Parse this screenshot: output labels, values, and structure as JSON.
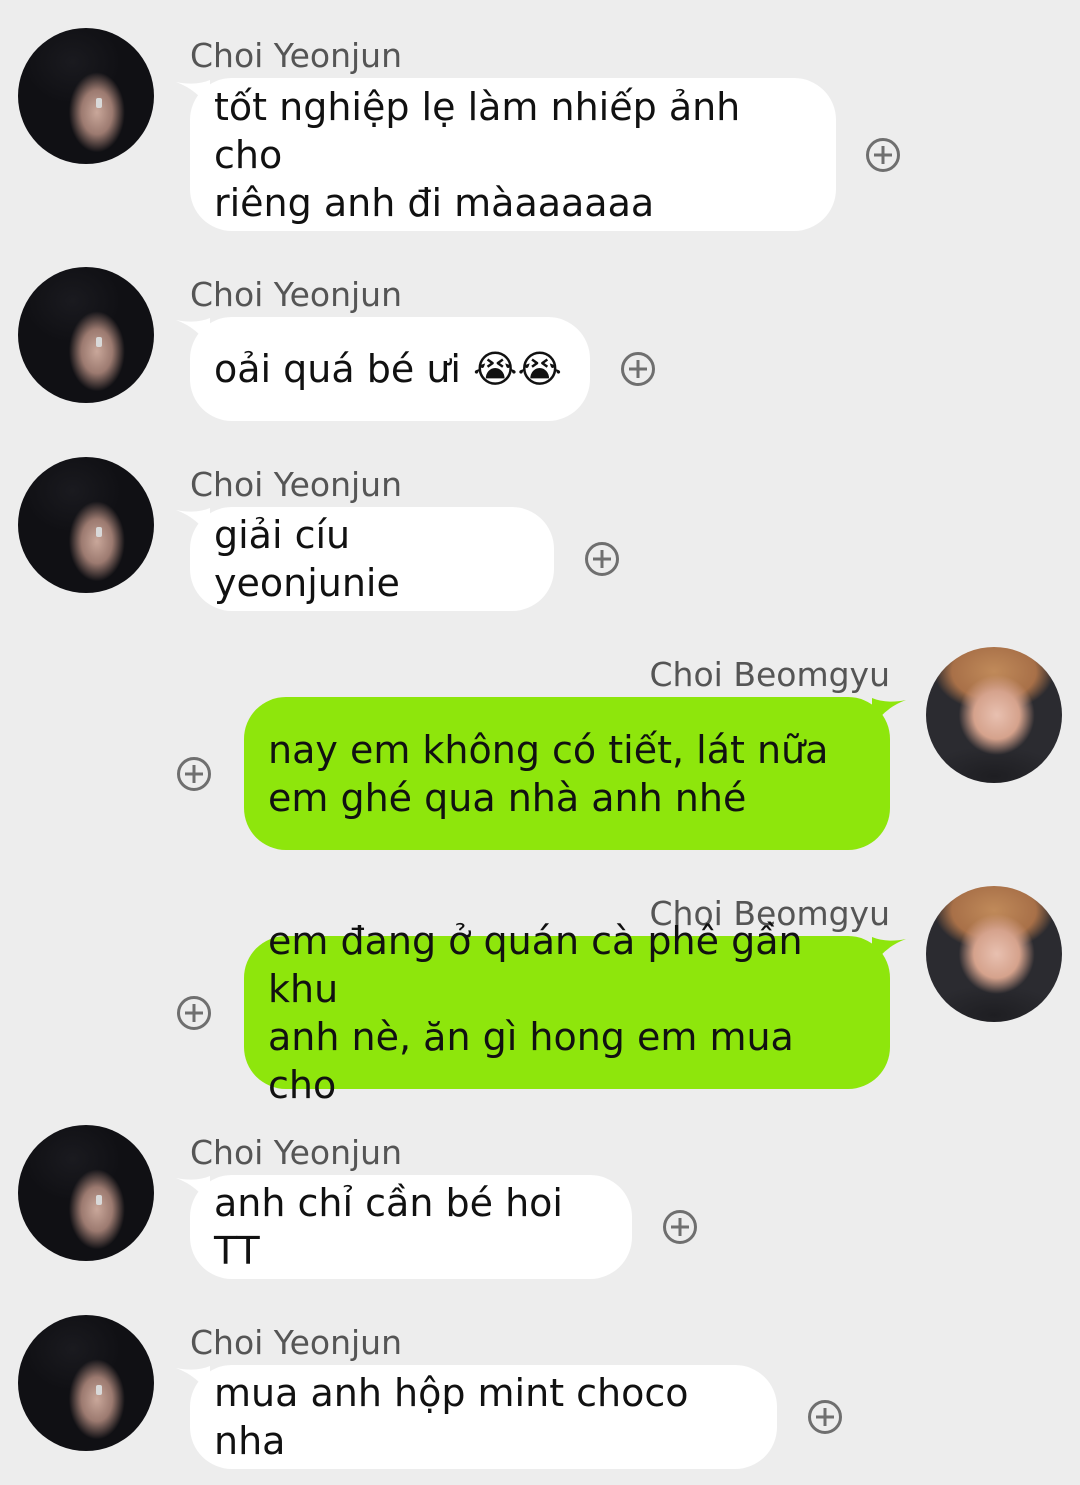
{
  "colors": {
    "background": "#ededed",
    "incoming_bubble": "#ffffff",
    "outgoing_bubble": "#8ee60c",
    "sender_name": "#555555",
    "plus_icon": "#6f6f6f"
  },
  "messages": [
    {
      "sender": "Choi Yeonjun",
      "direction": "incoming",
      "text": "tốt nghiệp lẹ làm nhiếp ảnh cho\nriêng anh đi màaaaaaa"
    },
    {
      "sender": "Choi Yeonjun",
      "direction": "incoming",
      "text": "oải quá bé ưi 😭😭"
    },
    {
      "sender": "Choi Yeonjun",
      "direction": "incoming",
      "text": "giải cíu yeonjunie"
    },
    {
      "sender": "Choi Beomgyu",
      "direction": "outgoing",
      "text": "nay em không có tiết, lát nữa\nem ghé qua nhà anh nhé"
    },
    {
      "sender": "Choi Beomgyu",
      "direction": "outgoing",
      "text": "em đang ở quán cà phê gần khu\nanh nè, ăn gì hong em mua cho"
    },
    {
      "sender": "Choi Yeonjun",
      "direction": "incoming",
      "text": "anh chỉ cần bé hoi TT"
    },
    {
      "sender": "Choi Yeonjun",
      "direction": "incoming",
      "text": "mua anh hộp mint choco nha"
    }
  ]
}
